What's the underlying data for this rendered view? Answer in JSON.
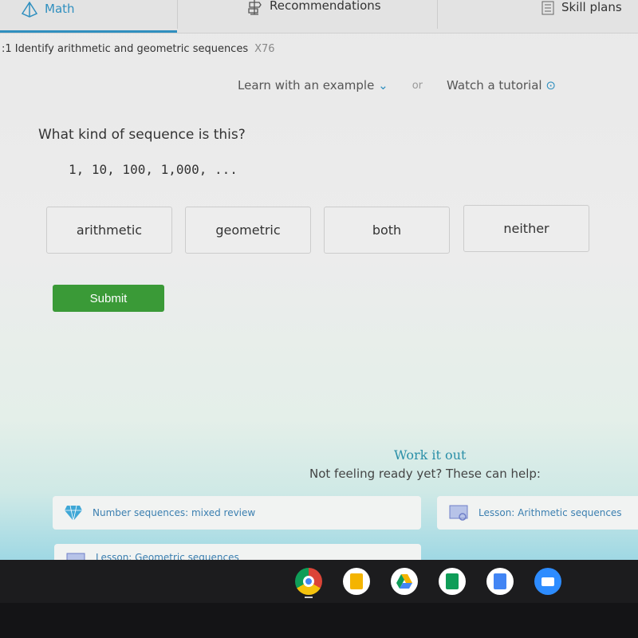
{
  "nav": {
    "tabs": [
      {
        "label": "Math",
        "icon": "pyramid-icon",
        "active": true
      },
      {
        "label": "Recommendations",
        "icon": "signpost-icon"
      },
      {
        "label": "Skill plans",
        "icon": "checklist-icon"
      }
    ]
  },
  "breadcrumb": {
    "skill": ":1 Identify arithmetic and geometric sequences",
    "code": "X76"
  },
  "help": {
    "learn": "Learn with an example",
    "or": "or",
    "tutorial": "Watch a tutorial"
  },
  "question": {
    "prompt": "What kind of sequence is this?",
    "sequence": "1, 10, 100, 1,000, ...",
    "choices": [
      "arithmetic",
      "geometric",
      "both",
      "neither"
    ],
    "submit": "Submit"
  },
  "work": {
    "title": "Work it out",
    "subtitle": "Not feeling ready yet? These can help:",
    "cards": [
      {
        "label": "Number sequences: mixed review",
        "icon": "diamond-icon"
      },
      {
        "label": "Lesson: Arithmetic sequences",
        "icon": "lesson-icon"
      },
      {
        "label": "Lesson: Geometric sequences",
        "icon": "lesson-icon"
      }
    ]
  },
  "colors": {
    "accent": "#2f8fbf",
    "submit": "#3a9a37",
    "link": "#3b7fb0"
  },
  "shelf": {
    "apps": [
      "chrome-icon",
      "slides-icon",
      "drive-icon",
      "sheets-icon",
      "docs-icon",
      "zoom-icon"
    ]
  }
}
